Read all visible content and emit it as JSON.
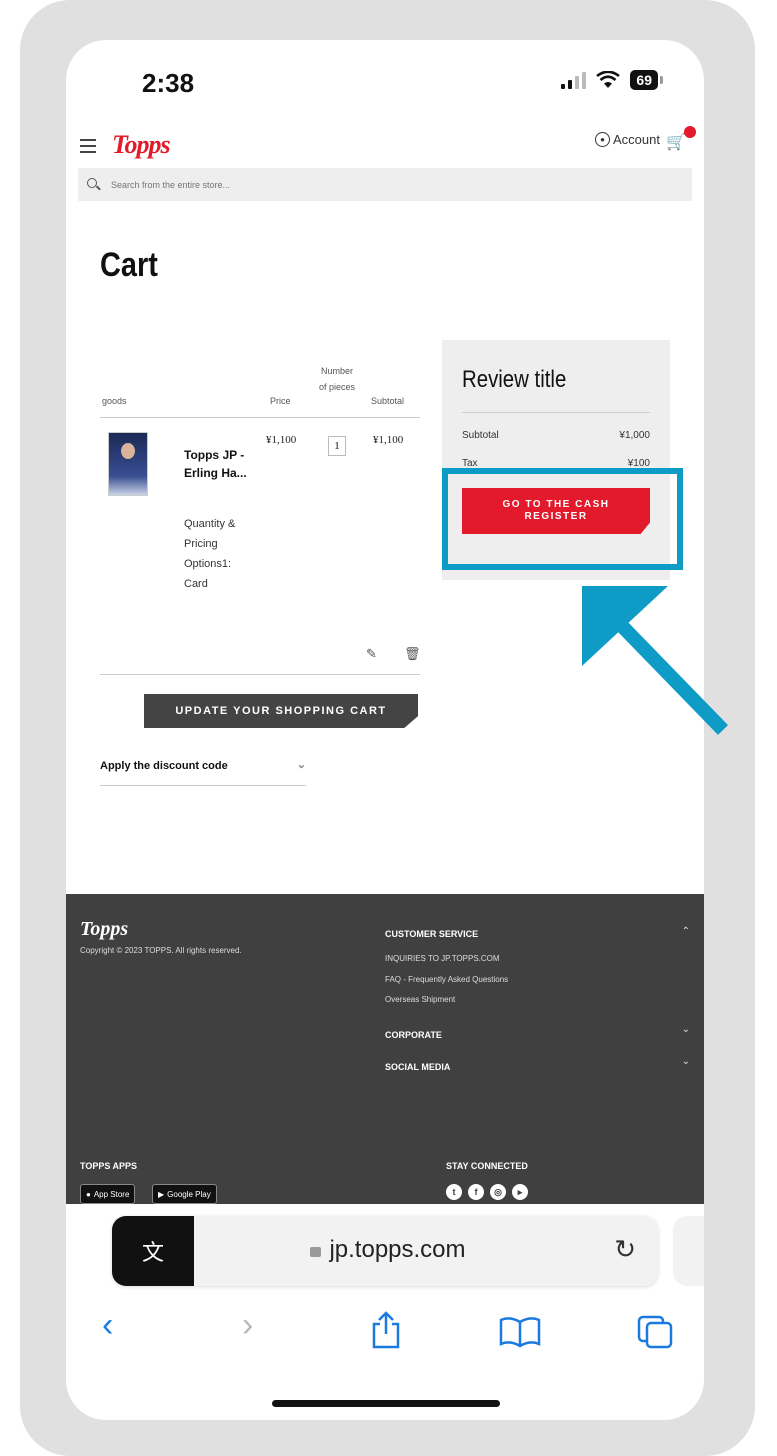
{
  "status": {
    "time": "2:38",
    "battery": "69"
  },
  "header": {
    "logo": "Topps",
    "account": "Account"
  },
  "search": {
    "placeholder": "Search from the entire store..."
  },
  "page": {
    "title": "Cart"
  },
  "cart": {
    "headers": {
      "goods": "goods",
      "price": "Price",
      "number_of_pieces": "Number of pieces",
      "subtotal": "Subtotal"
    },
    "items": [
      {
        "name": "Topps JP - Erling Ha...",
        "options": "Quantity & Pricing Options1: Card",
        "price": "¥1,100",
        "qty": "1",
        "subtotal": "¥1,100"
      }
    ],
    "update_button": "UPDATE YOUR SHOPPING CART",
    "discount_label": "Apply the discount code"
  },
  "summary": {
    "title": "Review title",
    "subtotal_label": "Subtotal",
    "subtotal_value": "¥1,000",
    "tax_label": "Tax",
    "tax_value": "¥100",
    "checkout_button": "GO TO THE CASH REGISTER",
    "highlight_color": "#0e9bc6",
    "button_color": "#e21a2c"
  },
  "footer": {
    "logo": "Topps",
    "copyright": "Copyright © 2023 TOPPS. All rights reserved.",
    "customer_service": "CUSTOMER SERVICE",
    "links": [
      "INQUIRIES TO JP.TOPPS.COM",
      "FAQ - Frequently Asked Questions",
      "Overseas Shipment"
    ],
    "corporate": "CORPORATE",
    "social_media": "SOCIAL MEDIA",
    "apps_heading": "TOPPS APPS",
    "app_store": "App Store",
    "google_play": "Google Play",
    "stay_connected": "STAY CONNECTED"
  },
  "browser": {
    "url": "jp.topps.com"
  }
}
